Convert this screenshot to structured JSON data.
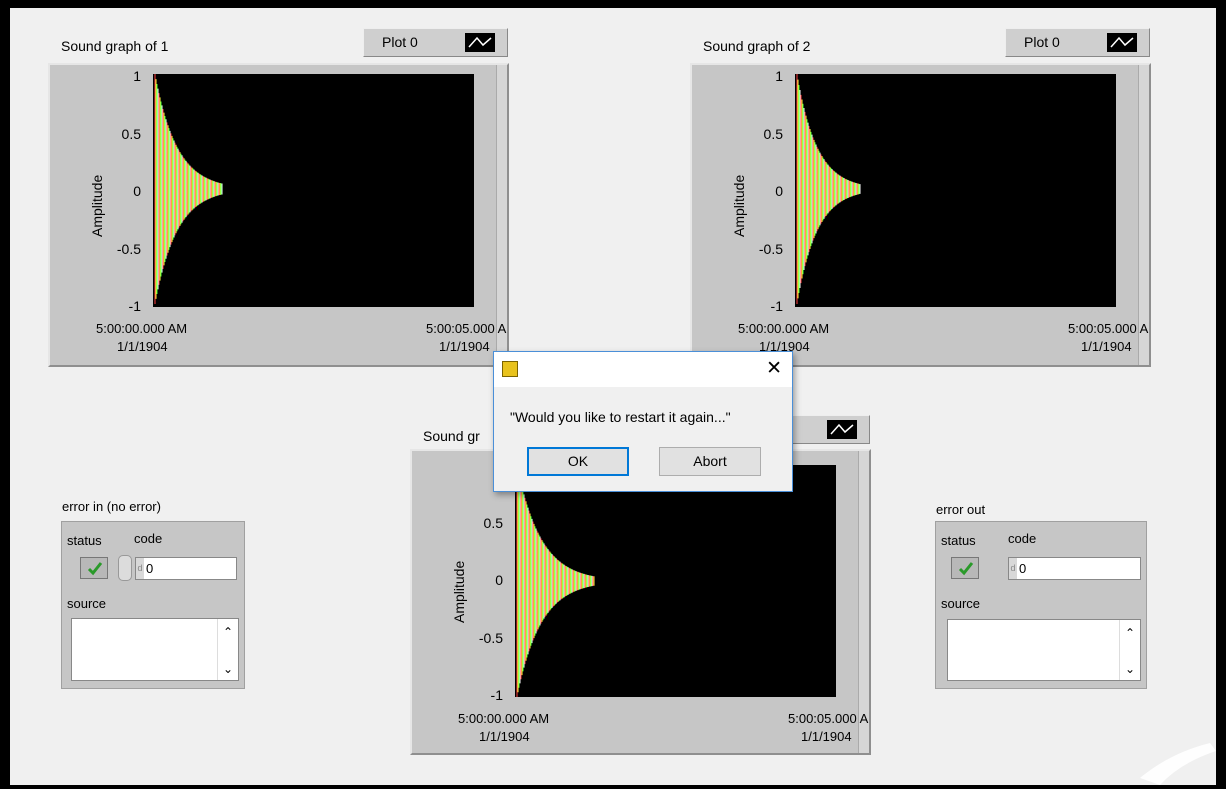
{
  "graphs": [
    {
      "title": "Sound graph of 1",
      "legend": "Plot 0",
      "ylabel": "Amplitude",
      "yticks": [
        "1",
        "0.5",
        "0",
        "-0.5",
        "-1"
      ],
      "xstart_time": "5:00:00.000 AM",
      "xstart_date": "1/1/1904",
      "xend_time": "5:00:05.000 A",
      "xend_date": "1/1/1904"
    },
    {
      "title": "Sound graph of 2",
      "legend": "Plot 0",
      "ylabel": "Amplitude",
      "yticks": [
        "1",
        "0.5",
        "0",
        "-0.5",
        "-1"
      ],
      "xstart_time": "5:00:00.000 AM",
      "xstart_date": "1/1/1904",
      "xend_time": "5:00:05.000 A",
      "xend_date": "1/1/1904"
    },
    {
      "title": "Sound gr",
      "legend": "",
      "ylabel": "Amplitude",
      "yticks": [
        "0.5",
        "0",
        "-0.5",
        "-1"
      ],
      "xstart_time": "5:00:00.000 AM",
      "xstart_date": "1/1/1904",
      "xend_time": "5:00:05.000 A",
      "xend_date": "1/1/1904"
    }
  ],
  "error_in": {
    "title": "error in (no error)",
    "status_label": "status",
    "code_label": "code",
    "code_value": "0",
    "radix": "d",
    "source_label": "source"
  },
  "error_out": {
    "title": "error out",
    "status_label": "status",
    "code_label": "code",
    "code_value": "0",
    "radix": "d",
    "source_label": "source"
  },
  "dialog": {
    "message": "\"Would you like to restart it again...\"",
    "ok_label": "OK",
    "abort_label": "Abort",
    "close_glyph": "✕"
  },
  "colors": {
    "plot_background": "#000000",
    "waveform": [
      "#ff4040",
      "#ffff40",
      "#40ff40",
      "#ffffff"
    ],
    "status_ok": "#2a9a2a"
  }
}
